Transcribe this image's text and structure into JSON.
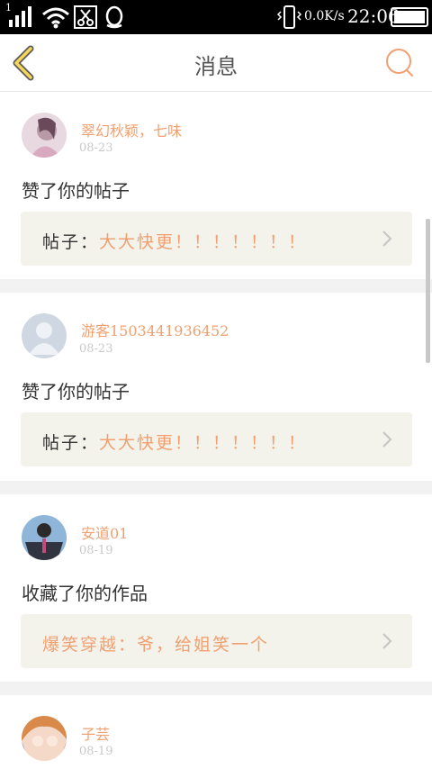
{
  "status_bar": {
    "network_speed": "0.0K/s",
    "time": "22:06",
    "sim_indicator": "1",
    "icons": [
      "signal-icon",
      "wifi-icon",
      "scissors-icon",
      "qq-icon",
      "vibrate-icon",
      "battery-icon"
    ]
  },
  "header": {
    "title": "消息",
    "back_icon": "chevron-left-icon",
    "search_icon": "search-icon"
  },
  "colors": {
    "accent": "#f0a071",
    "back_icon": "#f5d55a",
    "post_box": "#f3f3ec",
    "date": "#c9c9c9"
  },
  "notifications": [
    {
      "username": "翠幻秋颖，七味",
      "date": "08-23",
      "action": "赞了你的帖子",
      "post_label": "帖子：",
      "post_title": "大大快更！！！！！！！"
    },
    {
      "username": "游客1503441936452",
      "date": "08-23",
      "action": "赞了你的帖子",
      "post_label": "帖子：",
      "post_title": "大大快更！！！！！！！"
    },
    {
      "username": "安道01",
      "date": "08-19",
      "action": "收藏了你的作品",
      "post_label": "",
      "post_title": "爆笑穿越：爷，给姐笑一个"
    },
    {
      "username": "子芸",
      "date": "08-19"
    }
  ]
}
